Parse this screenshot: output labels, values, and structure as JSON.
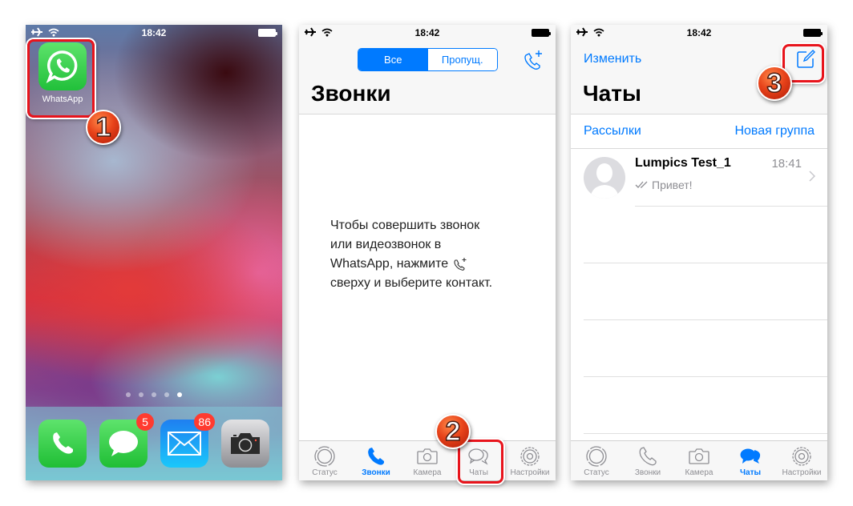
{
  "screens": {
    "home": {
      "status_bar": {
        "time": "18:42"
      },
      "app": {
        "label": "WhatsApp"
      },
      "page_dots": {
        "count": 5,
        "active_index": 4
      },
      "dock": [
        {
          "name": "Phone",
          "badge": null
        },
        {
          "name": "Messages",
          "badge": "5"
        },
        {
          "name": "Mail",
          "badge": "86"
        },
        {
          "name": "Camera",
          "badge": null
        }
      ]
    },
    "calls": {
      "status_bar": {
        "time": "18:42"
      },
      "segments": [
        {
          "label": "Все",
          "selected": true
        },
        {
          "label": "Пропущ.",
          "selected": false
        }
      ],
      "title": "Звонки",
      "empty_message": {
        "line1": "Чтобы совершить звонок",
        "line2": "или видеозвонок в",
        "line3": "WhatsApp, нажмите",
        "line4": "сверху и выберите контакт."
      },
      "tabs": [
        {
          "label": "Статус",
          "icon": "status-icon",
          "active": false
        },
        {
          "label": "Звонки",
          "icon": "phone-icon",
          "active": true
        },
        {
          "label": "Камера",
          "icon": "camera-icon",
          "active": false
        },
        {
          "label": "Чаты",
          "icon": "chats-icon",
          "active": false
        },
        {
          "label": "Настройки",
          "icon": "settings-icon",
          "active": false
        }
      ]
    },
    "chats": {
      "status_bar": {
        "time": "18:42"
      },
      "edit_label": "Изменить",
      "title": "Чаты",
      "broadcast_label": "Рассылки",
      "new_group_label": "Новая группа",
      "chats": [
        {
          "name": "Lumpics Test_1",
          "time": "18:41",
          "preview": "Привет!",
          "read": true
        }
      ],
      "tabs": [
        {
          "label": "Статус",
          "icon": "status-icon",
          "active": false
        },
        {
          "label": "Звонки",
          "icon": "phone-icon",
          "active": false
        },
        {
          "label": "Камера",
          "icon": "camera-icon",
          "active": false
        },
        {
          "label": "Чаты",
          "icon": "chats-icon",
          "active": true
        },
        {
          "label": "Настройки",
          "icon": "settings-icon",
          "active": false
        }
      ]
    }
  },
  "annotations": [
    {
      "step": "1",
      "target": "WhatsApp app icon"
    },
    {
      "step": "2",
      "target": "Чаты tab"
    },
    {
      "step": "3",
      "target": "New chat button"
    }
  ],
  "colors": {
    "accent": "#007aff",
    "highlight": "#e8141c",
    "badge": "#ff3b30",
    "whatsapp_green": "#25d366"
  }
}
